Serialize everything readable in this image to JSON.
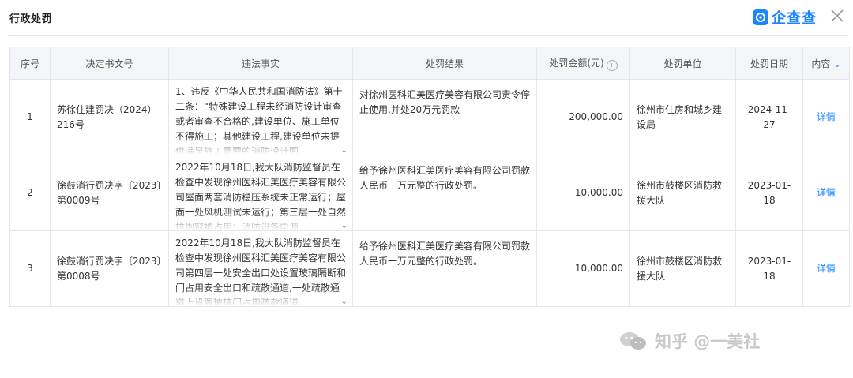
{
  "page": {
    "title": "行政处罚"
  },
  "brand": {
    "name": "企查查",
    "logo_icon": "qcc-logo-icon"
  },
  "table": {
    "headers": {
      "index": "序号",
      "doc_no": "决定书文号",
      "violation": "违法事实",
      "result": "处罚结果",
      "amount": "处罚金额(元)",
      "unit": "处罚单位",
      "date": "处罚日期",
      "content": "内容"
    },
    "rows": [
      {
        "index": "1",
        "doc_no": "苏徐住建罚决（2024）216号",
        "violation": "1、违反《中华人民共和国消防法》第十二条：“特殊建设工程未经消防设计审查或者审查不合格的,建设单位、施工单位不得施工；其他建设工程,建设单位未提供满足施工需要的消防设计图",
        "result": "对徐州医科汇美医疗美容有限公司责令停止使用,并处20万元罚款",
        "amount": "200,000.00",
        "unit": "徐州市住房和城乡建设局",
        "date": "2024-11-27",
        "detail": "详情"
      },
      {
        "index": "2",
        "doc_no": "徐鼓消行罚决字〔2023〕第0009号",
        "violation": "2022年10月18日,我大队消防监督员在检查中发现徐州医科汇美医疗美容有限公司屋面两套消防稳压系统未正常运行；屋面一处风机测试未运行；第三层一处自然排烟窗被占用；消防设备电源",
        "result": "给予徐州医科汇美医疗美容有限公司罚款人民币一万元整的行政处罚。",
        "amount": "10,000.00",
        "unit": "徐州市鼓楼区消防救援大队",
        "date": "2023-01-18",
        "detail": "详情"
      },
      {
        "index": "3",
        "doc_no": "徐鼓消行罚决字〔2023〕第0008号",
        "violation": "2022年10月18日,我大队消防监督员在检查中发现徐州医科汇美医疗美容有限公司第四层一处安全出口处设置玻璃隔断和门占用安全出口和疏散通道,一处疏散通道上设置玻璃门占用疏散通道,",
        "result": "给予徐州医科汇美医疗美容有限公司罚款人民币一万元整的行政处罚。",
        "amount": "10,000.00",
        "unit": "徐州市鼓楼区消防救援大队",
        "date": "2023-01-18",
        "detail": "详情"
      }
    ]
  },
  "watermark": {
    "text": "知乎 @一美社"
  },
  "colors": {
    "accent": "#1b84ff",
    "header_bg": "#f3f5f8",
    "border": "#e4e6ea"
  }
}
